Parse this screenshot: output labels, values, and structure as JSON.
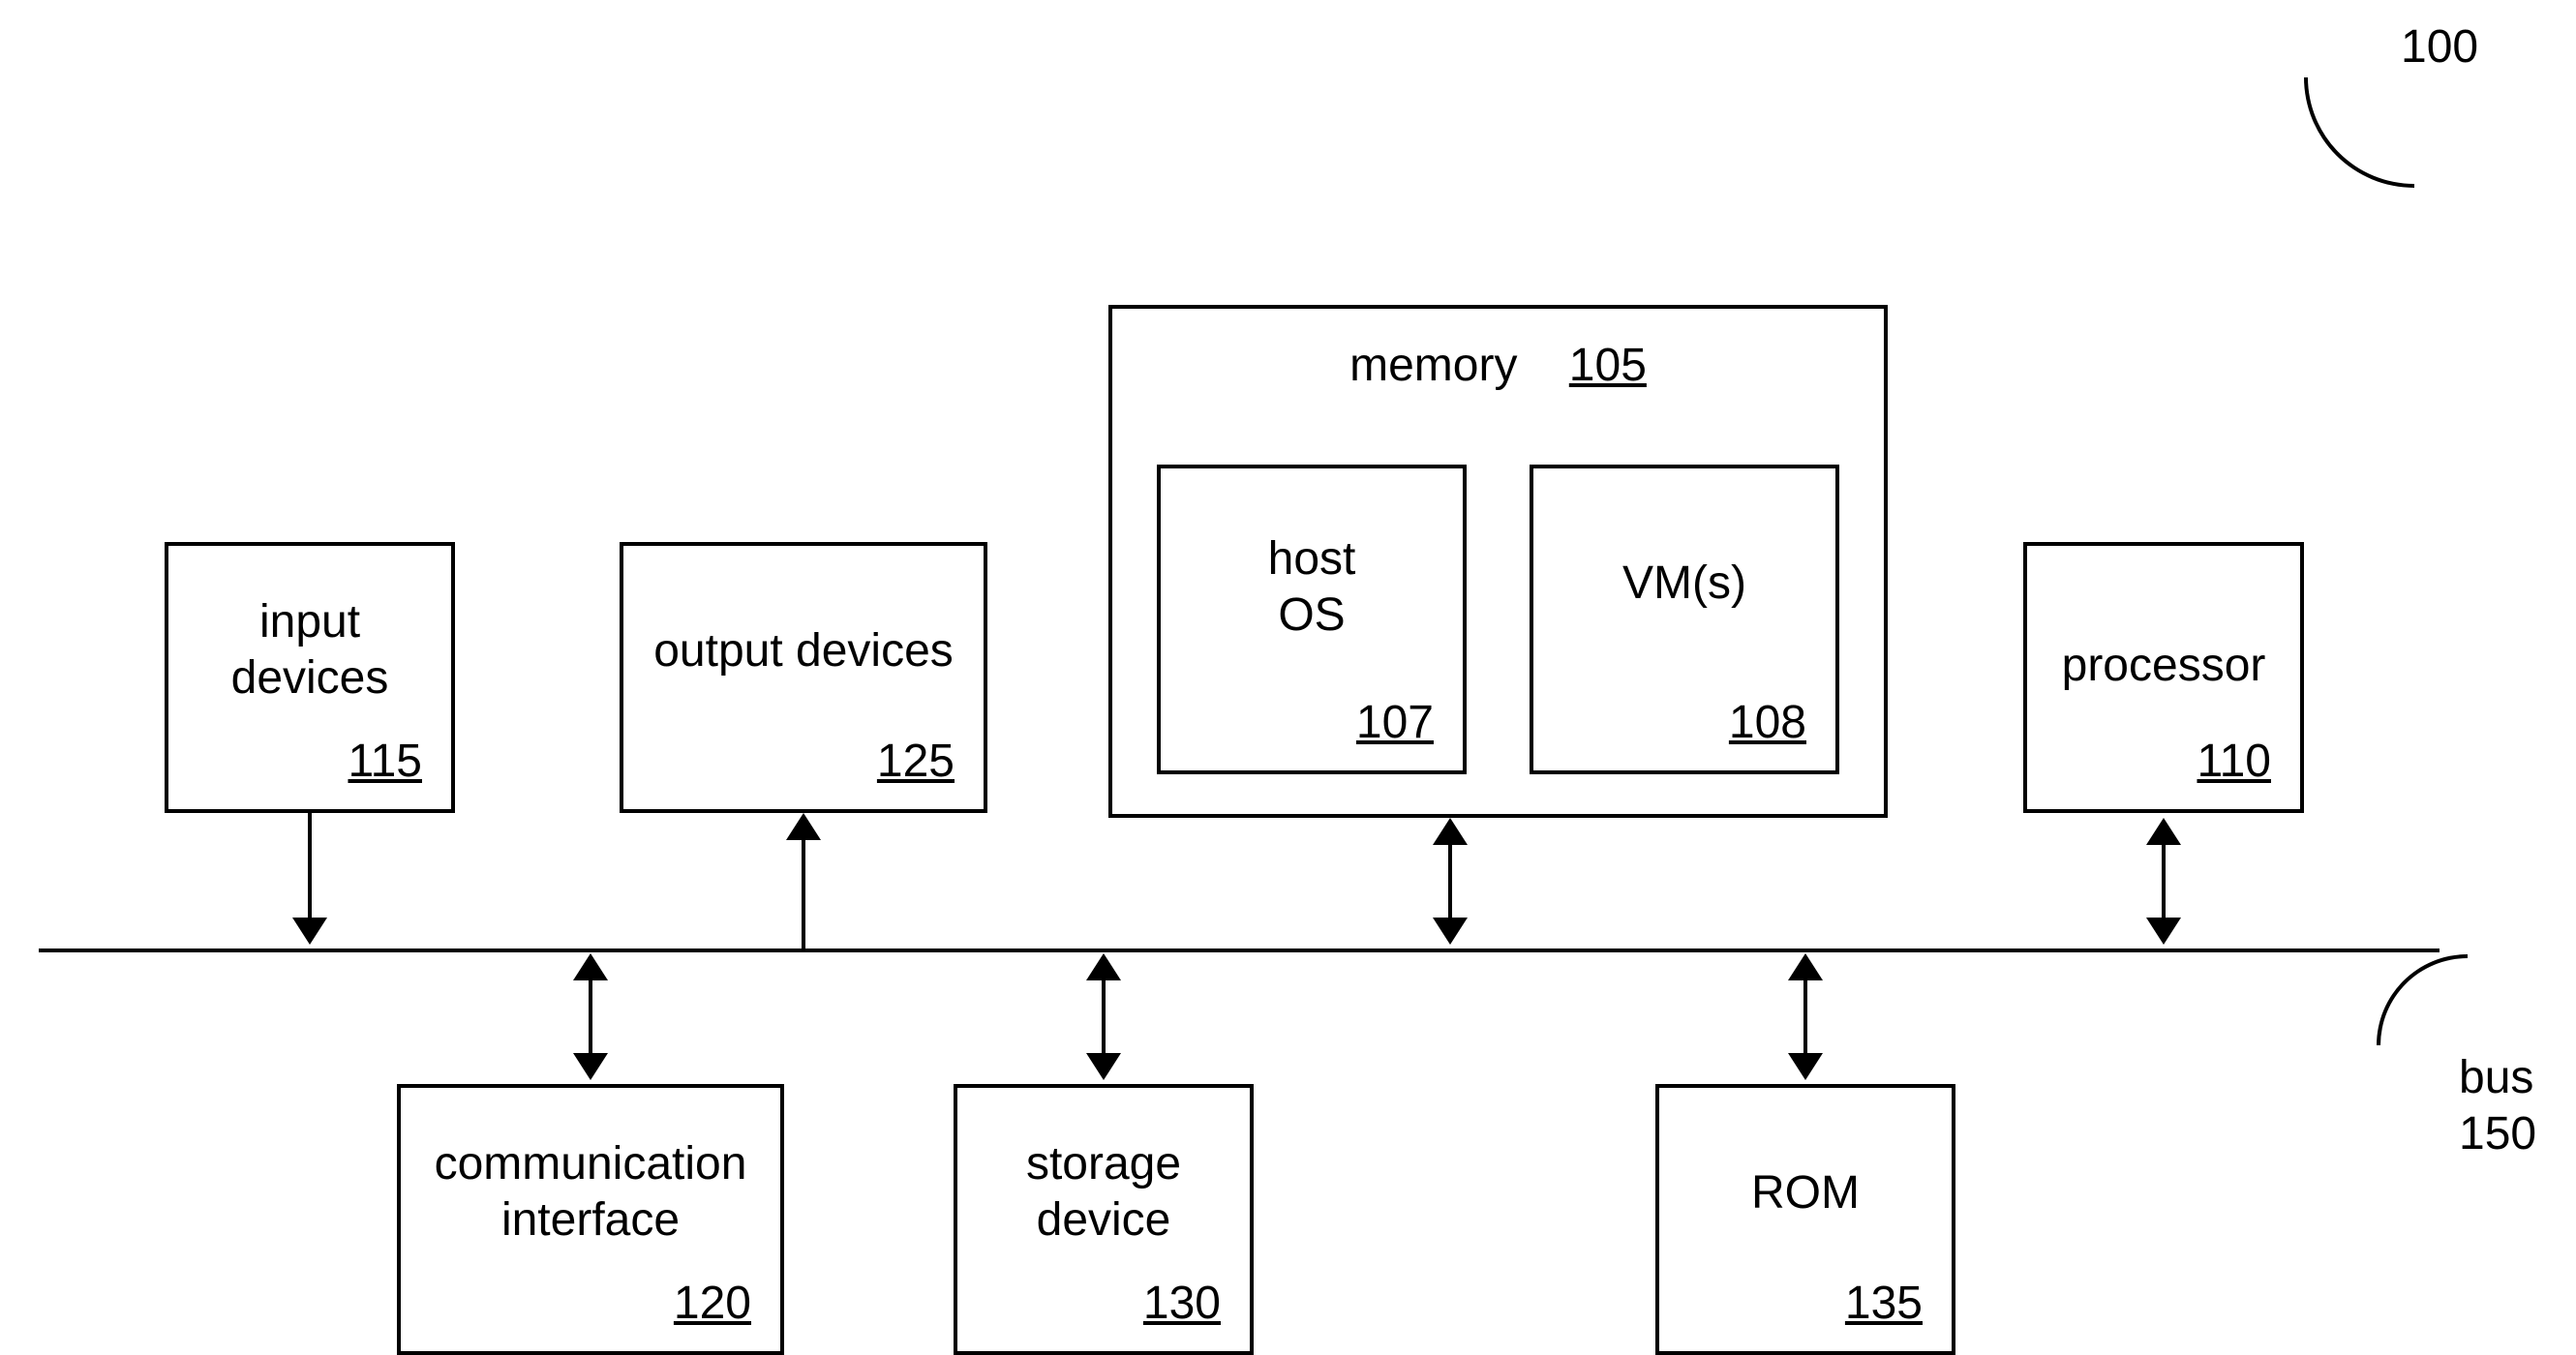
{
  "figure_ref": "100",
  "bus": {
    "label": "bus",
    "ref": "150"
  },
  "memory": {
    "label": "memory",
    "ref": "105"
  },
  "host_os": {
    "label_line1": "host",
    "label_line2": "OS",
    "ref": "107"
  },
  "vms": {
    "label": "VM(s)",
    "ref": "108"
  },
  "input_devices": {
    "label_line1": "input",
    "label_line2": "devices",
    "ref": "115"
  },
  "output_devices": {
    "label": "output devices",
    "ref": "125"
  },
  "processor": {
    "label": "processor",
    "ref": "110"
  },
  "comm_interface": {
    "label_line1": "communication",
    "label_line2": "interface",
    "ref": "120"
  },
  "storage_device": {
    "label_line1": "storage",
    "label_line2": "device",
    "ref": "130"
  },
  "rom": {
    "label": "ROM",
    "ref": "135"
  }
}
